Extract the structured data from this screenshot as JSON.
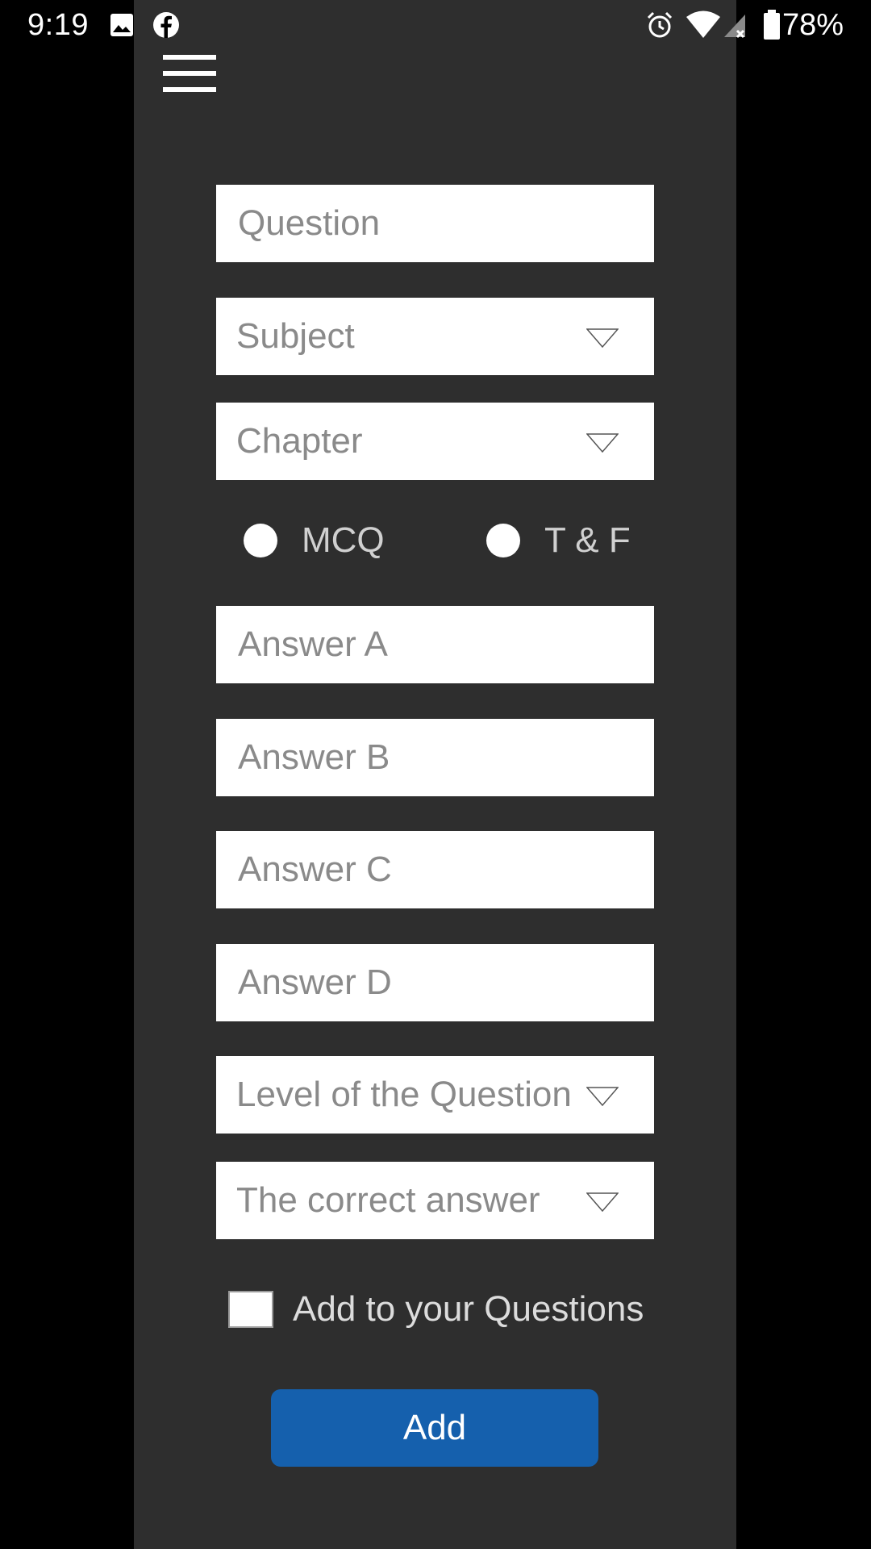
{
  "status_bar": {
    "time": "9:19",
    "battery_percent": "78%",
    "icons": [
      "image-icon",
      "facebook-icon",
      "alarm-icon",
      "wifi-icon",
      "signal-icon",
      "battery-icon"
    ]
  },
  "menu": {
    "icon": "hamburger-menu-icon"
  },
  "form": {
    "question_placeholder": "Question",
    "subject_label": "Subject",
    "chapter_label": "Chapter",
    "type_options": {
      "mcq": "MCQ",
      "tf": "T & F"
    },
    "answer_a_placeholder": "Answer A",
    "answer_b_placeholder": "Answer B",
    "answer_c_placeholder": "Answer C",
    "answer_d_placeholder": "Answer D",
    "level_label": "Level of the Question",
    "correct_answer_label": "The correct answer",
    "add_to_questions_label": "Add to your Questions",
    "add_button_label": "Add"
  },
  "colors": {
    "panel_background": "#2e2e2e",
    "accent_button": "#1560ad"
  }
}
